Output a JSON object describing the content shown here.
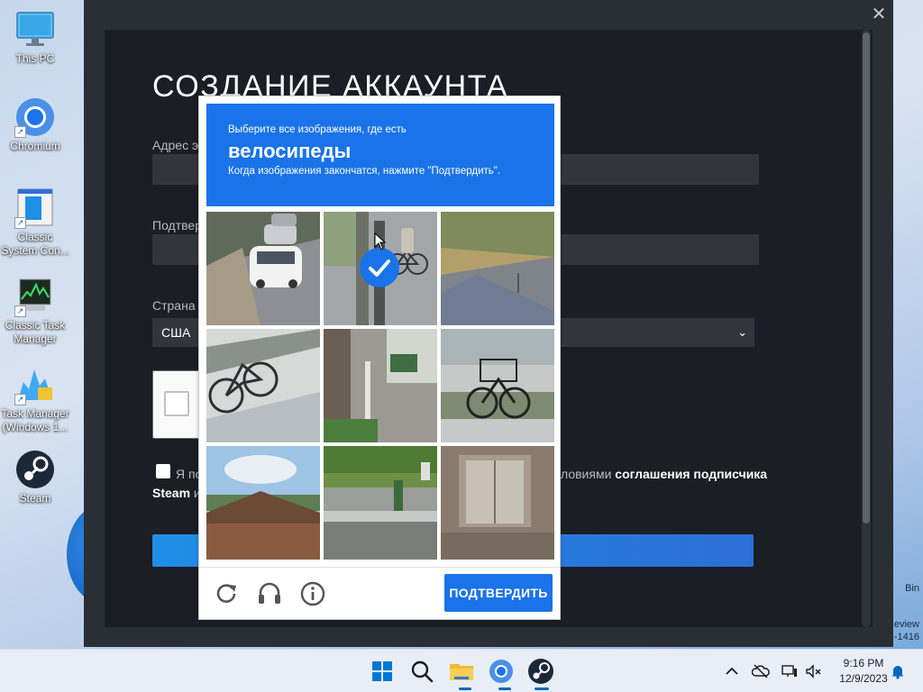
{
  "desktop": {
    "icons": [
      {
        "label": "This PC"
      },
      {
        "label": "Chromium"
      },
      {
        "label": "Classic System Con..."
      },
      {
        "label": "Classic Task Manager"
      },
      {
        "label": "Task Manager (Windows 1..."
      },
      {
        "label": "Steam"
      }
    ],
    "right_peek": {
      "line1": "Bin",
      "line2": "eview",
      "line3": "-1416"
    }
  },
  "steam": {
    "title": "СОЗДАНИЕ АККАУНТА",
    "email_label": "Адрес э",
    "confirm_label": "Подтвер",
    "country_label": "Страна",
    "country_value": "США",
    "agree_left": "Я по",
    "agree_right_prefix": "ловиями ",
    "agree_right_link": "соглашения подписчика",
    "agree_line2_link": "Steam",
    "agree_line2_rest": " и"
  },
  "recaptcha": {
    "instruction": "Выберите все изображения, где есть",
    "target": "велосипеды",
    "hint": "Когда изображения закончатся, нажмите \"Подтвердить\".",
    "verify_label": "ПОДТВЕРДИТЬ",
    "tiles": [
      {
        "scene": "street-cars",
        "selected": false
      },
      {
        "scene": "sidewalk-bicycle",
        "selected": true
      },
      {
        "scene": "road-shadow",
        "selected": false
      },
      {
        "scene": "bicycle-shadow",
        "selected": false
      },
      {
        "scene": "narrow-street",
        "selected": false
      },
      {
        "scene": "parked-bicycle",
        "selected": false
      },
      {
        "scene": "old-house",
        "selected": false
      },
      {
        "scene": "guardrail",
        "selected": false
      },
      {
        "scene": "building-window",
        "selected": false
      }
    ]
  },
  "taskbar": {
    "time": "9:16 PM",
    "date": "12/9/2023",
    "apps": [
      "start-icon",
      "search-icon",
      "file-explorer-icon",
      "chromium-icon",
      "steam-icon"
    ]
  },
  "colors": {
    "recaptcha_blue": "#1a73e8",
    "steam_bg": "#1b1e24",
    "steam_frame": "#2a2e35"
  }
}
